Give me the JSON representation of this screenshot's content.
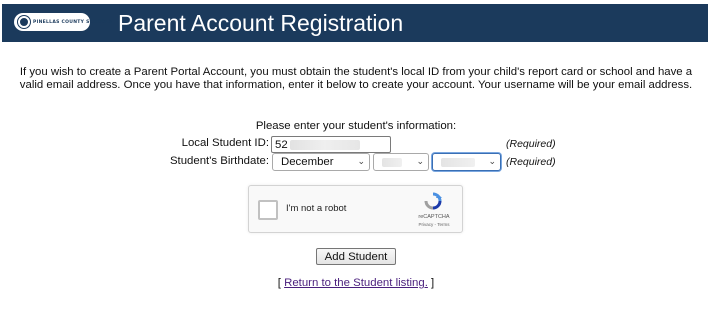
{
  "header": {
    "title": "Parent Account Registration",
    "logo_text": "PINELLAS COUNTY SCHOOLS",
    "background_color": "#1b3a5c"
  },
  "intro": {
    "text": "If you wish to create a Parent Portal Account, you must obtain the student's local ID from your child's report card or school and have a valid email address. Once you have that information, enter it below to create your account. Your username will be your email address."
  },
  "form": {
    "prompt": "Please enter your student's information:",
    "student_id": {
      "label": "Local Student ID:",
      "value": "52",
      "required_note": "(Required)"
    },
    "birthdate": {
      "label": "Student's Birthdate:",
      "month_value": "December",
      "day_value": "",
      "year_value": "",
      "required_note": "(Required)"
    },
    "captcha": {
      "checkbox_label": "I'm not a robot",
      "brand": "reCAPTCHA",
      "links": "Privacy - Terms"
    },
    "submit_label": "Add Student"
  },
  "footer": {
    "open_bracket": "[",
    "link_text": "Return to the Student listing.",
    "close_bracket": "]"
  }
}
